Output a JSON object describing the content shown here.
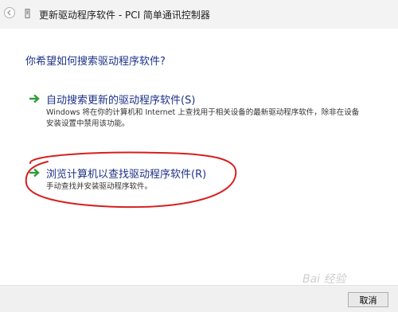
{
  "window": {
    "title": "更新驱动程序软件 - PCI 简单通讯控制器"
  },
  "heading": "你希望如何搜索驱动程序软件?",
  "options": [
    {
      "title": "自动搜索更新的驱动程序软件(S)",
      "description": "Windows 将在你的计算机和 Internet 上查找用于相关设备的最新驱动程序软件，除非在设备安装设置中禁用该功能。"
    },
    {
      "title": "浏览计算机以查找驱动程序软件(R)",
      "description": "手动查找并安装驱动程序软件。"
    }
  ],
  "footer": {
    "cancel_label": "取消"
  },
  "watermark": "Bai 经验",
  "colors": {
    "accent_text": "#1e3287",
    "arrow_green": "#2e9e3b",
    "annotation_red": "#d61f1f"
  }
}
